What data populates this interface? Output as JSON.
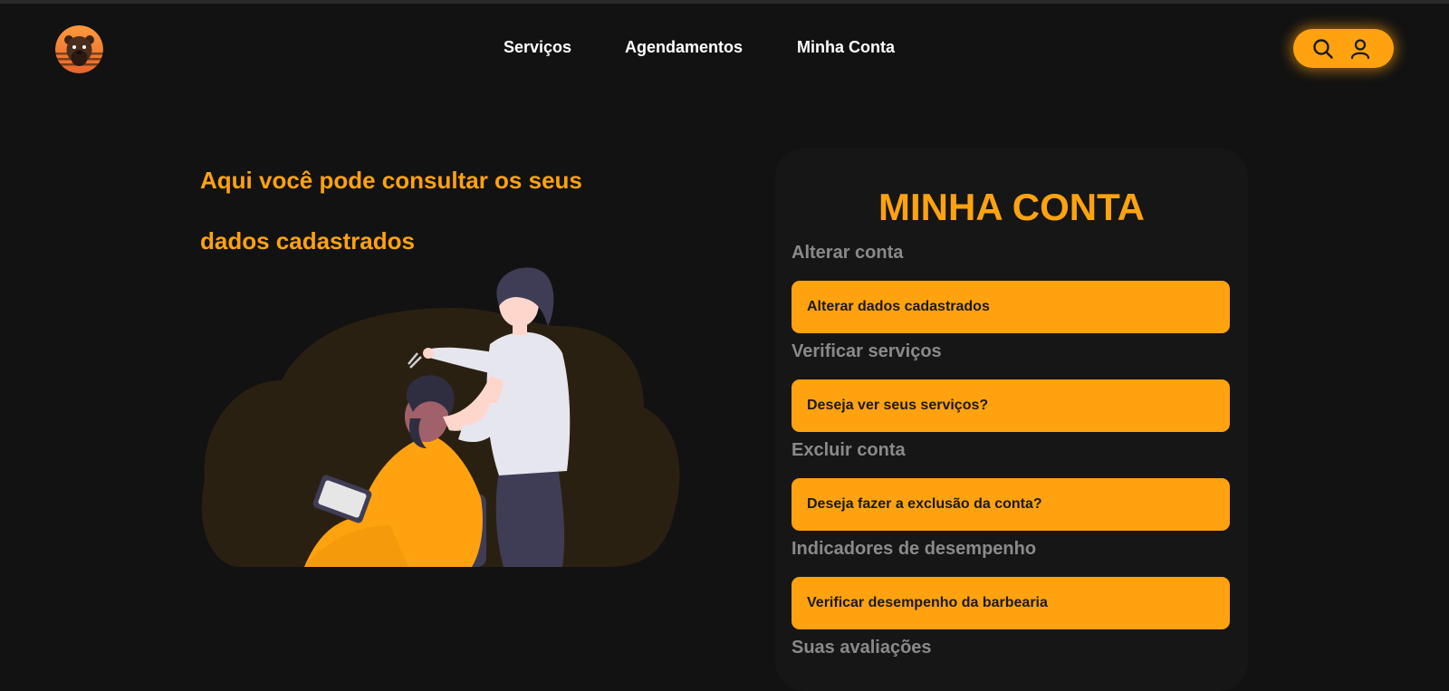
{
  "nav": {
    "items": [
      "Serviços",
      "Agendamentos",
      "Minha Conta"
    ],
    "search_icon": "search-icon",
    "user_icon": "user-icon"
  },
  "brand": {
    "logo_icon": "bear-logo-icon"
  },
  "hero": {
    "line1": "Aqui você pode consultar os seus",
    "line2": "dados cadastrados"
  },
  "account": {
    "title": "MINHA CONTA",
    "sections": [
      {
        "label": "Alterar conta",
        "button": "Alterar dados cadastrados"
      },
      {
        "label": "Verificar serviços",
        "button": "Deseja ver seus serviços?"
      },
      {
        "label": "Excluir conta",
        "button": "Deseja fazer a exclusão da conta?"
      },
      {
        "label": "Indicadores de desempenho",
        "button": "Verificar desempenho da barbearia"
      },
      {
        "label": "Suas avaliações"
      }
    ]
  },
  "colors": {
    "accent": "#ffa20f",
    "background": "#121212",
    "card": "#161616",
    "muted_label": "#8a8a8a"
  }
}
